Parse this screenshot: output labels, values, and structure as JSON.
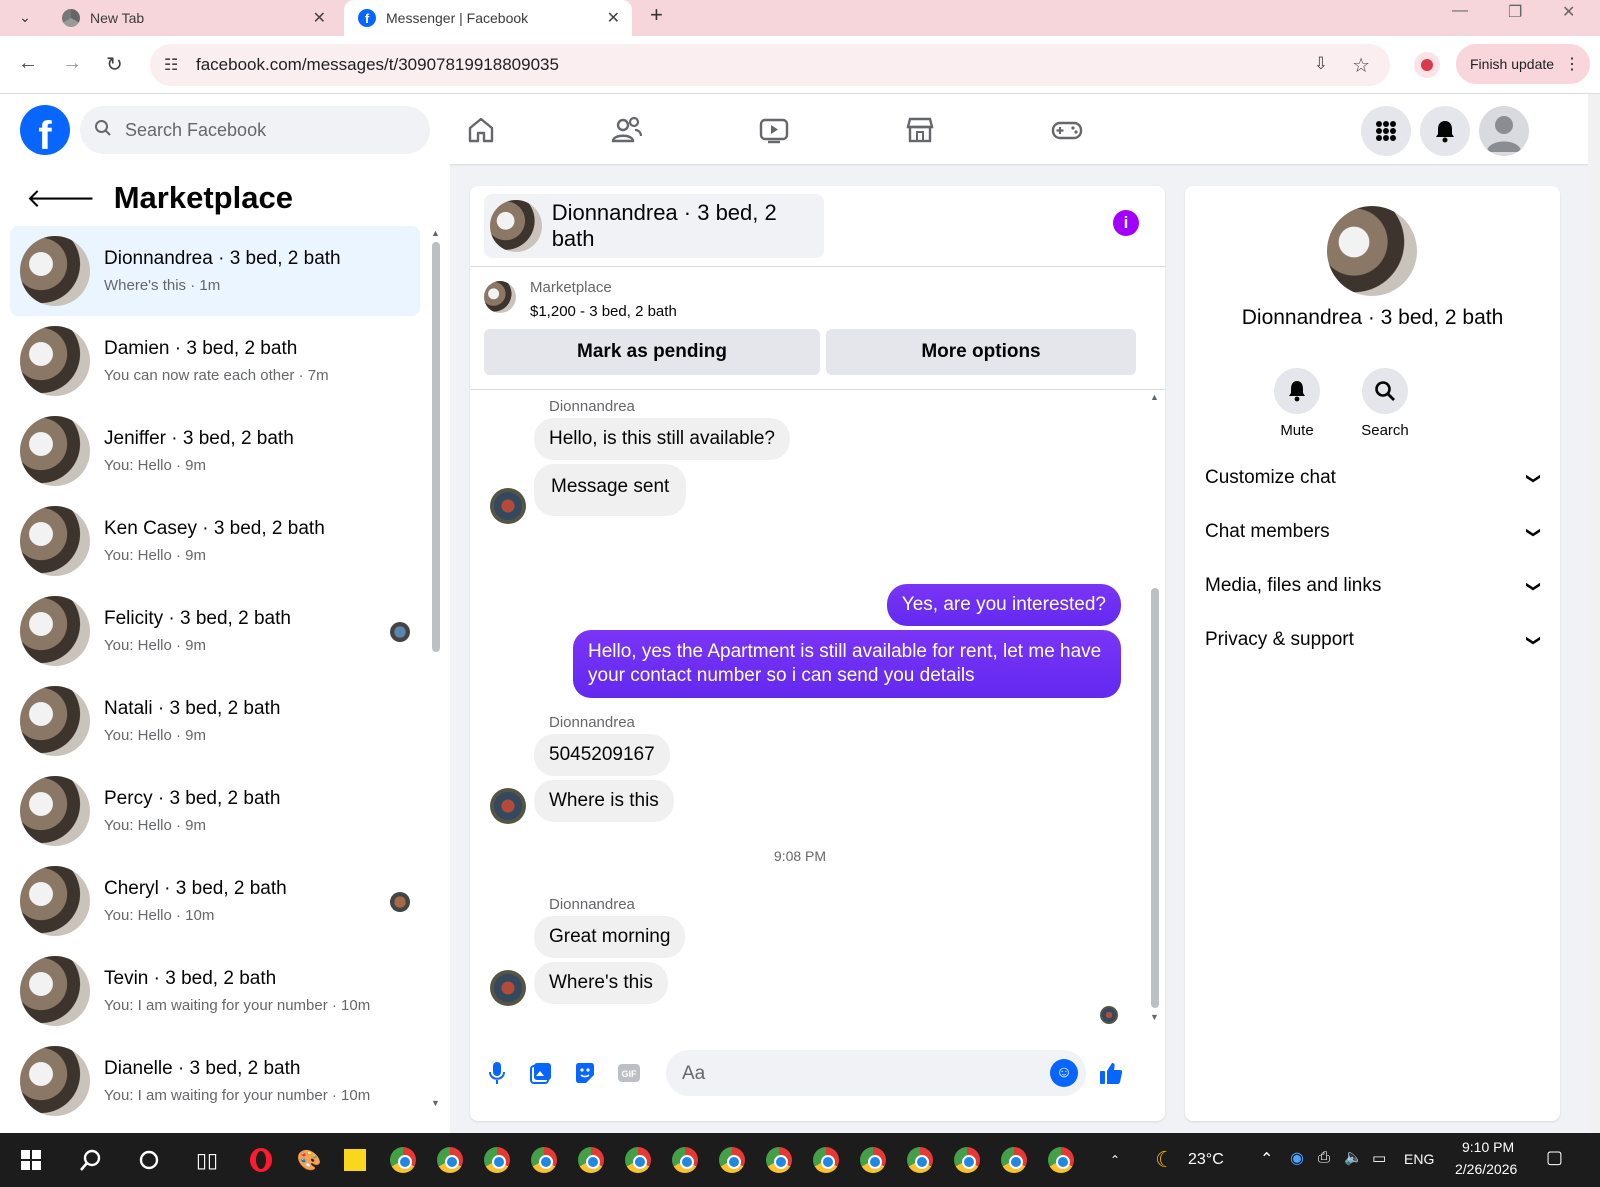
{
  "browser": {
    "tabs": [
      {
        "title": "New Tab",
        "icon": "chrome-icon"
      },
      {
        "title": "Messenger | Facebook",
        "icon": "facebook-icon"
      }
    ],
    "url": "facebook.com/messages/t/30907819918809035",
    "finish_update": "Finish update"
  },
  "fb_header": {
    "logo_letter": "f",
    "search_placeholder": "Search Facebook",
    "nav_icons": [
      "home-icon",
      "friends-icon",
      "video-icon",
      "marketplace-icon",
      "gaming-icon"
    ],
    "right_icons": [
      "menu-grid-icon",
      "notifications-icon",
      "account-icon"
    ]
  },
  "sidebar": {
    "title": "Marketplace",
    "conversations": [
      {
        "name": "Dionnandrea · 3 bed, 2 bath",
        "preview": "Where's this · 1m",
        "active": true
      },
      {
        "name": "Damien · 3 bed, 2 bath",
        "preview": "You can now rate each other · 7m"
      },
      {
        "name": "Jeniffer · 3 bed, 2 bath",
        "preview": "You: Hello · 9m"
      },
      {
        "name": "Ken Casey · 3 bed, 2 bath",
        "preview": "You: Hello · 9m"
      },
      {
        "name": "Felicity · 3 bed, 2 bath",
        "preview": "You: Hello · 9m",
        "seen": true
      },
      {
        "name": "Natali · 3 bed, 2 bath",
        "preview": "You: Hello · 9m"
      },
      {
        "name": "Percy · 3 bed, 2 bath",
        "preview": "You: Hello · 9m"
      },
      {
        "name": "Cheryl · 3 bed, 2 bath",
        "preview": "You: Hello · 10m",
        "seen": true
      },
      {
        "name": "Tevin · 3 bed, 2 bath",
        "preview": "You: I am waiting for your number · 10m"
      },
      {
        "name": "Dianelle · 3 bed, 2 bath",
        "preview": "You: I am waiting for your number · 10m"
      }
    ]
  },
  "chat": {
    "header_name": "Dionnandrea · 3 bed, 2 bath",
    "info_label": "i",
    "listing": {
      "label": "Marketplace",
      "price": "$1,200 - 3 bed, 2 bath",
      "pending_button": "Mark as pending",
      "options_button": "More options"
    },
    "messages": {
      "sender1": "Dionnandrea",
      "m1": "Hello, is this still available?",
      "m2": "Message sent",
      "m3": "Yes, are you interested?",
      "m4a": "Hello, yes the Apartment is still available for rent, let me have",
      "m4b": "your contact number so i can send you details",
      "sender2": "Dionnandrea",
      "m5": "5045209167",
      "m6": "Where is this",
      "time": "9:08 PM",
      "sender3": "Dionnandrea",
      "m7": "Great morning",
      "m8": "Where's this"
    },
    "composer": {
      "placeholder": "Aa",
      "icons": [
        "microphone-icon",
        "photo-icon",
        "sticker-icon",
        "gif-icon",
        "emoji-icon",
        "like-icon"
      ]
    }
  },
  "details": {
    "name": "Dionnandrea · 3 bed, 2 bath",
    "actions": [
      {
        "label": "Mute",
        "icon": "bell-icon"
      },
      {
        "label": "Search",
        "icon": "search-icon"
      }
    ],
    "sections": [
      "Customize chat",
      "Chat members",
      "Media, files and links",
      "Privacy & support"
    ]
  },
  "taskbar": {
    "weather": "23°C",
    "language": "ENG",
    "time": "9:10 PM",
    "date": "2/26/2026"
  },
  "colors": {
    "fb_blue": "#0866ff",
    "outgoing_bubble": "#6a2ff2",
    "info_purple": "#a100ff",
    "tab_bar": "#f6d6da"
  }
}
